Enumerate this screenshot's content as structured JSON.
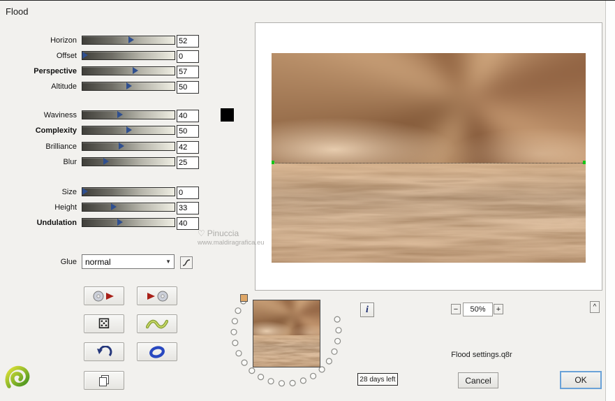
{
  "window": {
    "title": "Flood"
  },
  "sliders": [
    {
      "label": "Horizon",
      "value": "52",
      "pos": 52
    },
    {
      "label": "Offset",
      "value": "0",
      "pos": 2
    },
    {
      "label": "Perspective",
      "value": "57",
      "pos": 57
    },
    {
      "label": "Altitude",
      "value": "50",
      "pos": 50
    },
    {
      "label": "Waviness",
      "value": "40",
      "pos": 40
    },
    {
      "label": "Complexity",
      "value": "50",
      "pos": 50
    },
    {
      "label": "Brilliance",
      "value": "42",
      "pos": 42
    },
    {
      "label": "Blur",
      "value": "25",
      "pos": 25
    },
    {
      "label": "Size",
      "value": "0",
      "pos": 2
    },
    {
      "label": "Height",
      "value": "33",
      "pos": 33
    },
    {
      "label": "Undulation",
      "value": "40",
      "pos": 40
    }
  ],
  "glue": {
    "label": "Glue",
    "selected": "normal"
  },
  "icons": {
    "dice": "⚄"
  },
  "controls": {
    "info": "i",
    "zoom_out": "−",
    "zoom_level": "50%",
    "zoom_in": "+",
    "caret": "^"
  },
  "footer": {
    "settings_file": "Flood settings.q8r",
    "trial": "28 days left",
    "cancel": "Cancel",
    "ok": "OK"
  },
  "watermark": {
    "heart": "♡",
    "line1": "Pinuccia",
    "line2": "www.maldiragrafica.eu"
  },
  "colors": {
    "swatch": "#000000",
    "horizon_handle": "#17c517",
    "ok_focus_border": "#6aa2d8"
  }
}
